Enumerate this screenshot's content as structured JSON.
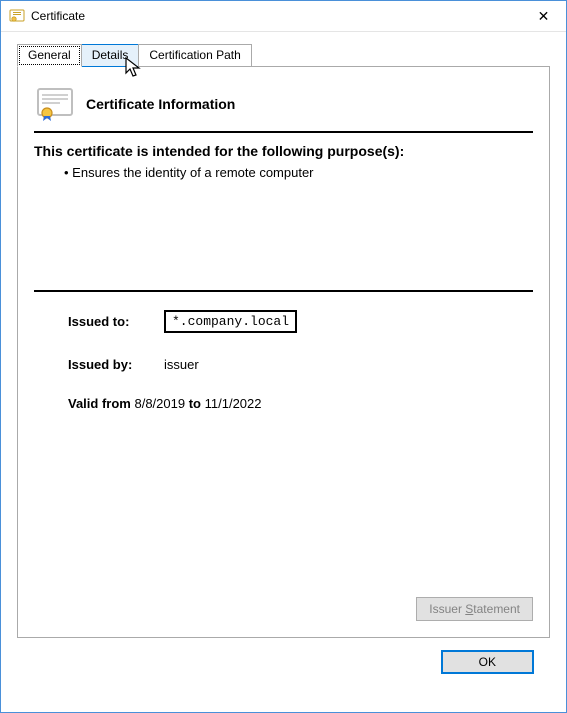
{
  "window": {
    "title": "Certificate",
    "close_glyph": "✕"
  },
  "tabs": {
    "general": "General",
    "details": "Details",
    "certpath": "Certification Path"
  },
  "info": {
    "heading": "Certificate Information",
    "purpose_label": "This certificate is intended for the following purpose(s):",
    "purposes": [
      "Ensures the identity of a remote computer"
    ]
  },
  "fields": {
    "issued_to_label": "Issued to:",
    "issued_to_value": "*.company.local",
    "issued_by_label": "Issued by:",
    "issued_by_value": "issuer",
    "valid_from_label": "Valid from",
    "valid_from_value": "8/8/2019",
    "valid_to_label": "to",
    "valid_to_value": "11/1/2022"
  },
  "buttons": {
    "issuer_statement_pre": "Issuer ",
    "issuer_statement_ul": "S",
    "issuer_statement_post": "tatement",
    "ok": "OK"
  }
}
